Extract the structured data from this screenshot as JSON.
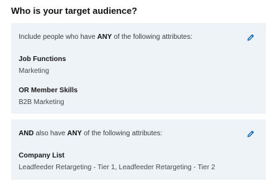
{
  "heading": "Who is your target audience?",
  "accent_color": "#0a66c2",
  "card_background": "#eef3f8",
  "include_card": {
    "intro_prefix": "Include people who have ",
    "intro_keyword": "ANY",
    "intro_suffix": " of the following attributes:",
    "edit_icon": "pencil-icon",
    "groups": [
      {
        "title": "Job Functions",
        "value": "Marketing"
      },
      {
        "title": "OR Member Skills",
        "value": "B2B Marketing"
      }
    ]
  },
  "and_card": {
    "intro_keyword_1": "AND",
    "intro_middle": " also have ",
    "intro_keyword_2": "ANY",
    "intro_suffix": " of the following attributes:",
    "edit_icon": "pencil-icon",
    "groups": [
      {
        "title": "Company List",
        "value": "Leadfeeder Retargeting - Tier 1, Leadfeeder Retargeting - Tier 2"
      }
    ]
  }
}
